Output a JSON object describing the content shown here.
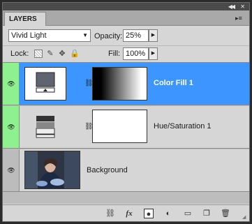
{
  "panel": {
    "tab_label": "LAYERS",
    "icons": {
      "collapse": "double-chevron-right-icon",
      "close": "close-icon",
      "panel_menu": "panel-menu-icon"
    }
  },
  "blend_mode": {
    "value": "Vivid Light"
  },
  "opacity": {
    "label": "Opacity:",
    "value": "25%"
  },
  "lock": {
    "label": "Lock:"
  },
  "fill": {
    "label": "Fill:",
    "value": "100%"
  },
  "layers": [
    {
      "name": "Color Fill 1",
      "selected": true,
      "visible": true
    },
    {
      "name": "Hue/Saturation 1",
      "selected": false,
      "visible": true
    },
    {
      "name": "Background",
      "selected": false,
      "visible": true
    }
  ],
  "colors": {
    "selected_row": "#3d95ff",
    "eye_column_active": "#8ef08e",
    "panel_bg": "#d6d6d6"
  },
  "bottom_icons": [
    "link-layers-icon",
    "fx-icon",
    "add-mask-icon",
    "adjustment-layer-icon",
    "new-group-icon",
    "new-layer-icon",
    "trash-icon"
  ],
  "fx_label": "fx"
}
